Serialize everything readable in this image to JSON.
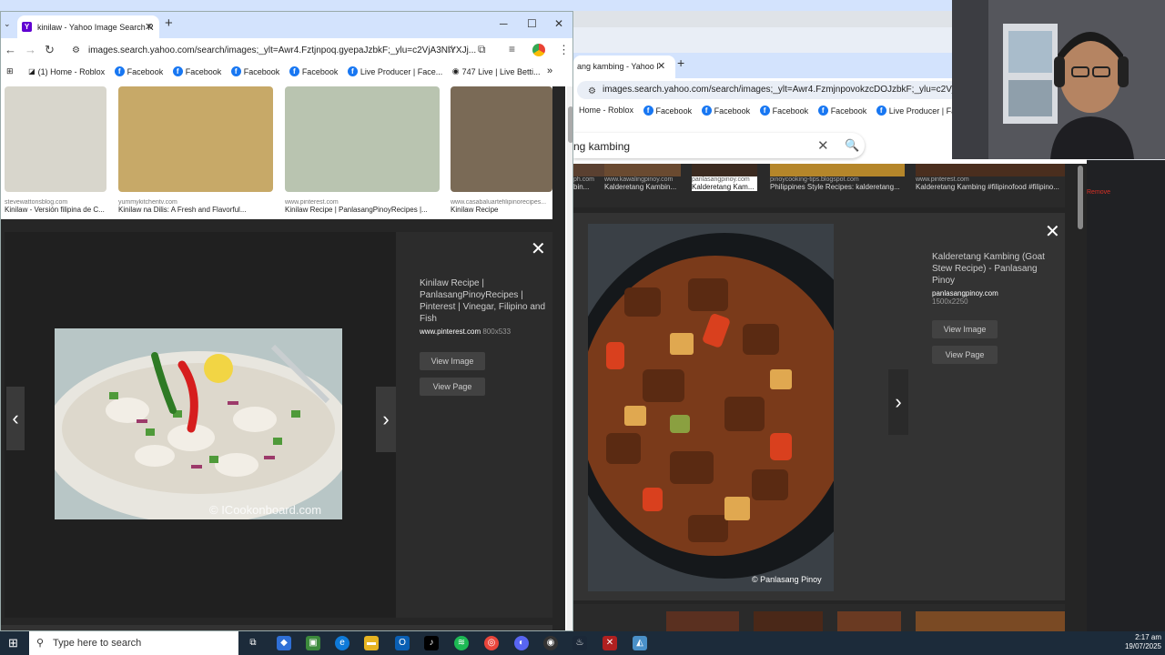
{
  "left_window": {
    "tab_title": "kinilaw - Yahoo Image Search R",
    "url": "images.search.yahoo.com/search/images;_ylt=Awr4.Fztjnpoq.gyepaJzbkF;_ylu=c2VjA3NlYXJj...",
    "bookmarks": [
      "(1) Home - Roblox",
      "Facebook",
      "Facebook",
      "Facebook",
      "Facebook",
      "Live Producer | Face...",
      "747 Live | Live Betti..."
    ],
    "thumbnails": [
      {
        "source": "stevewattonsblog.com",
        "title": "Kinilaw - Versión filipina de C..."
      },
      {
        "source": "yummykitchentv.com",
        "title": "Kinilaw na Dilis: A Fresh and Flavorful..."
      },
      {
        "source": "www.pinterest.com",
        "title": "Kinilaw Recipe | PanlasangPinoyRecipes |..."
      },
      {
        "source": "www.casabaluartefilipinorecipes...",
        "title": "Kinilaw Recipe"
      }
    ],
    "detail": {
      "title": "Kinilaw Recipe | PanlasangPinoyRecipes | Pinterest | Vinegar, Filipino and Fish",
      "domain": "www.pinterest.com",
      "size": "800x533",
      "watermark": "© ICookonboard.com",
      "view_image": "View Image",
      "view_page": "View Page"
    }
  },
  "right_window": {
    "tab_title": "ang kambing - Yahoo I",
    "url": "images.search.yahoo.com/search/images;_ylt=Awr4.FzmjnpovokzcDOJzbkF;_ylu=c2VjA3NIYX...",
    "bookmarks": [
      "Home - Roblox",
      "Facebook",
      "Facebook",
      "Facebook",
      "Facebook",
      "Live Producer | Face..."
    ],
    "search_query": "ng kambing",
    "strip": [
      {
        "source": "ph.com",
        "title": "bin..."
      },
      {
        "source": "www.kawalingpinoy.com",
        "title": "Kalderetang Kambin..."
      },
      {
        "source": "panlasangpinoy.com",
        "title": "Kalderetang Kam..."
      },
      {
        "source": "pinoycooking-tips.blogspot.com",
        "title": "Philippines Style Recipes: kalderetang..."
      },
      {
        "source": "www.pinterest.com",
        "title": "Kalderetang Kambing #filipinofood #filipino..."
      }
    ],
    "detail": {
      "title": "Kalderetang Kambing (Goat Stew Recipe) - Panlasang Pinoy",
      "domain": "panlasangpinoy.com",
      "size": "1500x2250",
      "watermark": "© Panlasang Pinoy",
      "view_image": "View Image",
      "view_page": "View Page"
    },
    "remove": "Remove"
  },
  "taskbar": {
    "search_placeholder": "Type here to search",
    "time": "2:17 am",
    "date": "19/07/2025"
  }
}
